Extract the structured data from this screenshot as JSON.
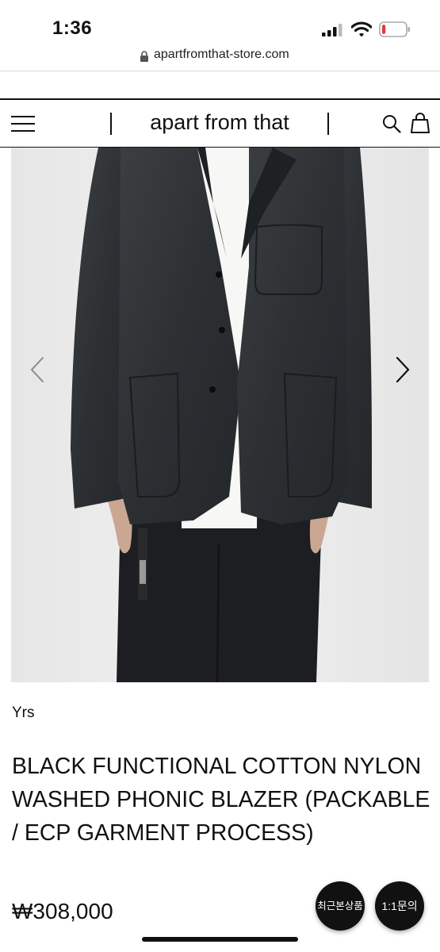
{
  "status_bar": {
    "time": "1:36",
    "battery_level": 0.15,
    "battery_color": "#e53935"
  },
  "browser": {
    "url": "apartfromthat-store.com"
  },
  "header": {
    "title": "apart from that"
  },
  "product": {
    "brand": "Yrs",
    "name": "BLACK FUNCTIONAL COTTON NYLON WASHED PHONIC BLAZER (PACKABLE / ECP GARMENT PROCESS)",
    "price": "₩308,000"
  },
  "floating": {
    "recent_label": "최근본상품",
    "inquiry_label": "1:1문의"
  },
  "icons": [
    "menu-icon",
    "search-icon",
    "shopping-bag-icon",
    "lock-icon",
    "chevron-left-icon",
    "chevron-right-icon",
    "wifi-icon",
    "signal-icon",
    "battery-icon"
  ],
  "colors": {
    "text": "#111111",
    "background": "#ffffff",
    "image_background": "#ececec",
    "fab": "#111111"
  }
}
